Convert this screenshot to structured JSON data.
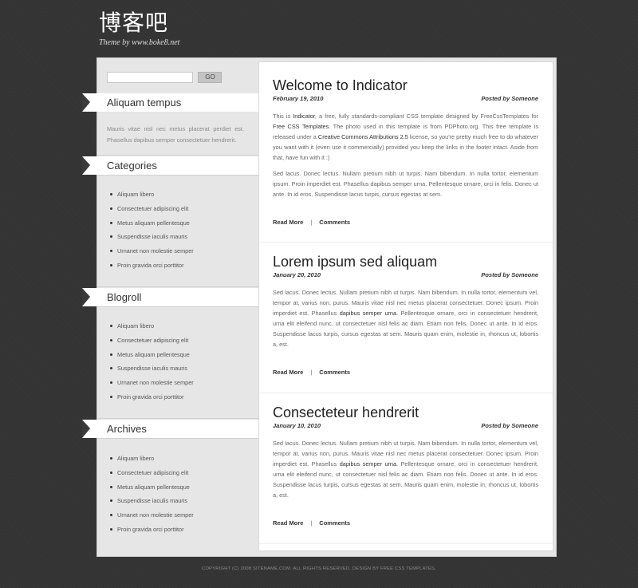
{
  "site": {
    "title": "博客吧",
    "subtitle": "Theme by www.boke8.net"
  },
  "search": {
    "value": "",
    "button_label": "GO"
  },
  "sidebar": {
    "about": {
      "title": "Aliquam tempus",
      "text": "Mauris vitae nisl nec metus placerat perdiet est. Phasellus dapibus semper consectetuer hendrerit."
    },
    "categories": {
      "title": "Categories",
      "items": [
        "Aliquam libero",
        "Consectetuer adipiscing elit",
        "Metus aliquam pellentesque",
        "Suspendisse iaculis mauris",
        "Urnanet non molestie semper",
        "Proin gravida orci porttitor"
      ]
    },
    "blogroll": {
      "title": "Blogroll",
      "items": [
        "Aliquam libero",
        "Consectetuer adipiscing elit",
        "Metus aliquam pellentesque",
        "Suspendisse iaculis mauris",
        "Urnanet non molestie semper",
        "Proin gravida orci porttitor"
      ]
    },
    "archives": {
      "title": "Archives",
      "items": [
        "Aliquam libero",
        "Consectetuer adipiscing elit",
        "Metus aliquam pellentesque",
        "Suspendisse iaculis mauris",
        "Urnanet non molestie semper",
        "Proin gravida orci porttitor"
      ]
    }
  },
  "posts": [
    {
      "title": "Welcome to Indicator",
      "date": "February 19, 2010",
      "author": "Posted by Someone",
      "p1": {
        "t1": "This is ",
        "b1": "Indicator",
        "t2": ", a free, fully standards-compliant CSS template designed by FreeCssTemplates for ",
        "b2": "Free CSS Templates",
        "t3": ". The photo used in this template is from PDPhoto.org. This free template is released under a ",
        "b3": "Creative Commons Attributions 2.5",
        "t4": " license, so you're pretty much free to do whatever you want with it (even use it commercially) provided you keep the links in the footer intact. Aside from that, have fun with it :)"
      },
      "p2": "Sed lacus. Donec lectus. Nullam pretium nibh ut turpis. Nam bibendum. In nulla tortor, elementum ipsum. Proin imperdiet est. Phasellus dapibus semper urna. Pellentesque ornare, orci in felis. Donec ut ante. In id eros. Suspendisse lacus turpis, cursus egestas at sem.",
      "read_more": "Read More",
      "separator": "|",
      "comments": "Comments"
    },
    {
      "title": "Lorem ipsum sed aliquam",
      "date": "January 20, 2010",
      "author": "Posted by Someone",
      "p1": {
        "t1": "Sed lacus. Donec lectus. Nullam pretium nibh ut turpis. Nam bibendum. In nulla tortor, elementum vel, tempor at, varius non, purus. Mauris vitae nisl nec metus placerat consectetuer. Donec ipsum. Proin imperdiet est. Phasellus ",
        "b1": "dapibus semper urna",
        "t2": ". Pellentesque ornare, orci in consectetuer hendrerit, urna elit eleifend nunc, ut consectetuer nisl felis ac diam. Etiam non felis. Donec ut ante. In id eros. Suspendisse lacus turpis, cursus egestas at sem. Mauris quam enim, molestie in, rhoncus ut, lobortis a, est."
      },
      "read_more": "Read More",
      "separator": "|",
      "comments": "Comments"
    },
    {
      "title": "Consecteteur hendrerit",
      "date": "January 10, 2010",
      "author": "Posted by Someone",
      "p1": {
        "t1": "Sed lacus. Donec lectus. Nullam pretium nibh ut turpis. Nam bibendum. In nulla tortor, elementum vel, tempor at, varius non, purus. Mauris vitae nisl nec metus placerat consectetuer. Donec ipsum. Proin imperdiet est. Phasellus ",
        "b1": "dapibus semper urna",
        "t2": ". Pellentesque ornare, orci in consectetuer hendrerit, urna elit eleifend nunc, ut consectetuer nisl felis ac diam. Etiam non felis. Donec ut ante. In id eros. Suspendisse lacus turpis, cursus egestas at sem. Mauris quam enim, molestie in, rhoncus ut, lobortis a, est."
      },
      "read_more": "Read More",
      "separator": "|",
      "comments": "Comments"
    }
  ],
  "footer": {
    "text": "COPYRIGHT (C) 2008 SITENAME.COM. ALL RIGHTS RESERVED. DESIGN BY FREE CSS TEMPLATES."
  }
}
